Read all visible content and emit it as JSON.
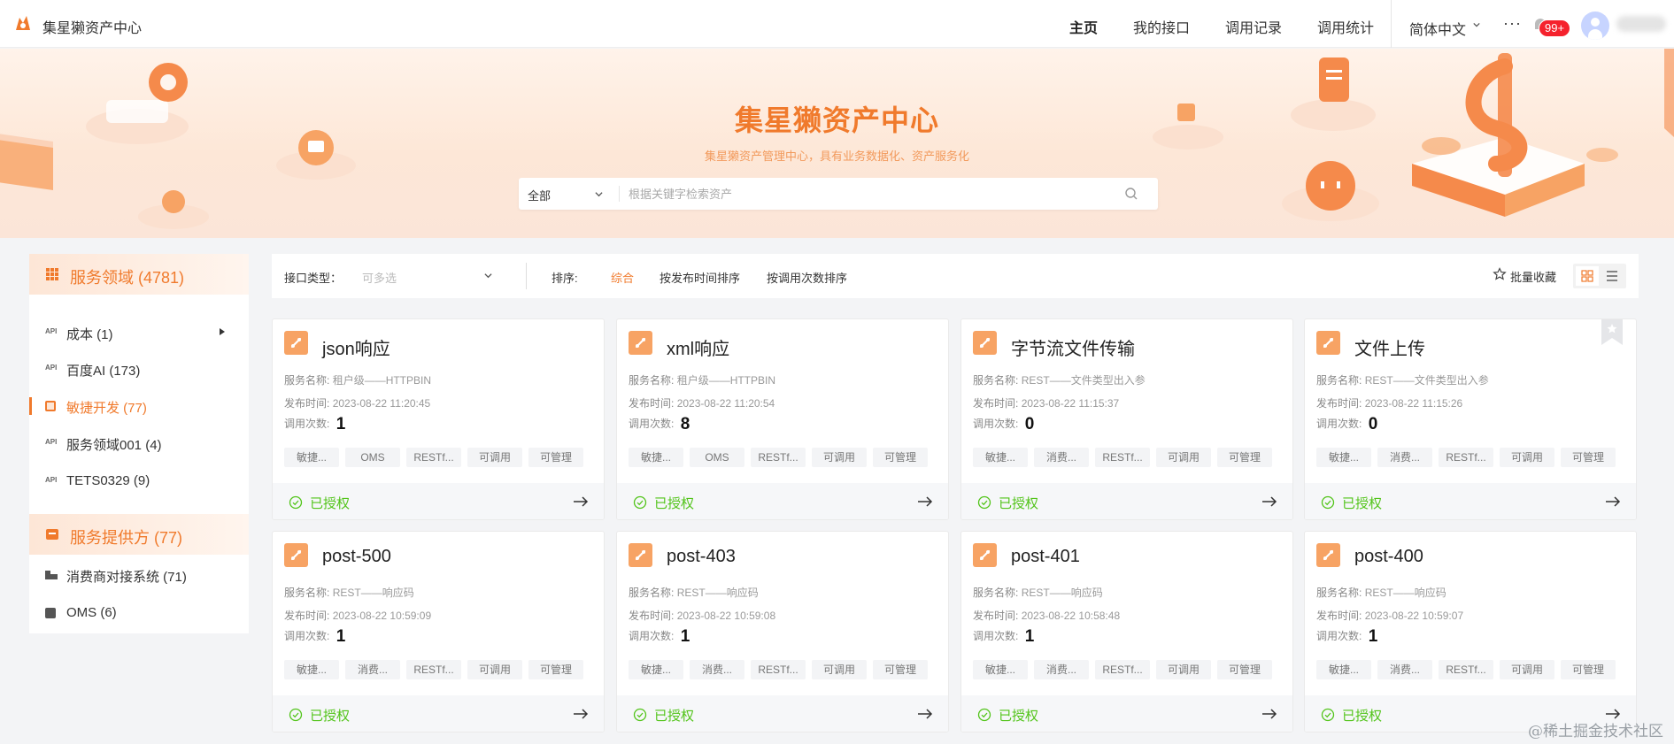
{
  "app": {
    "title": "集星獭资产中心"
  },
  "nav": {
    "items": [
      "主页",
      "我的接口",
      "调用记录",
      "调用统计"
    ],
    "language": "简体中文",
    "more": "···",
    "notification_badge": "99+"
  },
  "hero": {
    "title": "集星獭资产中心",
    "subtitle": "集星獭资产管理中心，具有业务数据化、资产服务化",
    "search": {
      "scope": "全部",
      "placeholder": "根据关键字检索资产"
    }
  },
  "sidebar": {
    "domains": {
      "header": "服务领域 (4781)",
      "items": [
        {
          "icon": "API",
          "label": "成本 (1)",
          "has_children": true,
          "active": false
        },
        {
          "icon": "API",
          "label": "百度AI (173)",
          "has_children": false,
          "active": false
        },
        {
          "icon": "square",
          "label": "敏捷开发 (77)",
          "has_children": false,
          "active": true
        },
        {
          "icon": "API",
          "label": "服务领域001 (4)",
          "has_children": false,
          "active": false
        },
        {
          "icon": "API",
          "label": "TETS0329 (9)",
          "has_children": false,
          "active": false
        }
      ]
    },
    "providers": {
      "header": "服务提供方 (77)",
      "items": [
        {
          "icon": "building",
          "label": "消费商对接系统 (71)"
        },
        {
          "icon": "square",
          "label": "OMS (6)"
        }
      ]
    }
  },
  "filter": {
    "type_label": "接口类型：",
    "type_placeholder": "可多选",
    "sort_label": "排序:",
    "sort_options": [
      "综合",
      "按发布时间排序",
      "按调用次数排序"
    ],
    "sort_active": 0,
    "batch_favorite": "批量收藏"
  },
  "labels": {
    "service_name": "服务名称:",
    "publish_time": "发布时间:",
    "call_count": "调用次数:",
    "authorized": "已授权"
  },
  "cards": [
    {
      "title": "json响应",
      "service": "租户级——HTTPBIN",
      "time": "2023-08-22 11:20:45",
      "calls": "1",
      "tags": [
        "敏捷...",
        "OMS",
        "RESTf...",
        "可调用",
        "可管理"
      ]
    },
    {
      "title": "xml响应",
      "service": "租户级——HTTPBIN",
      "time": "2023-08-22 11:20:54",
      "calls": "8",
      "tags": [
        "敏捷...",
        "OMS",
        "RESTf...",
        "可调用",
        "可管理"
      ]
    },
    {
      "title": "字节流文件传输",
      "service": "REST——文件类型出入参",
      "time": "2023-08-22 11:15:37",
      "calls": "0",
      "tags": [
        "敏捷...",
        "消费...",
        "RESTf...",
        "可调用",
        "可管理"
      ]
    },
    {
      "title": "文件上传",
      "service": "REST——文件类型出入参",
      "time": "2023-08-22 11:15:26",
      "calls": "0",
      "tags": [
        "敏捷...",
        "消费...",
        "RESTf...",
        "可调用",
        "可管理"
      ]
    },
    {
      "title": "post-500",
      "service": "REST——响应码",
      "time": "2023-08-22 10:59:09",
      "calls": "1",
      "tags": [
        "敏捷...",
        "消费...",
        "RESTf...",
        "可调用",
        "可管理"
      ]
    },
    {
      "title": "post-403",
      "service": "REST——响应码",
      "time": "2023-08-22 10:59:08",
      "calls": "1",
      "tags": [
        "敏捷...",
        "消费...",
        "RESTf...",
        "可调用",
        "可管理"
      ]
    },
    {
      "title": "post-401",
      "service": "REST——响应码",
      "time": "2023-08-22 10:58:48",
      "calls": "1",
      "tags": [
        "敏捷...",
        "消费...",
        "RESTf...",
        "可调用",
        "可管理"
      ]
    },
    {
      "title": "post-400",
      "service": "REST——响应码",
      "time": "2023-08-22 10:59:07",
      "calls": "1",
      "tags": [
        "敏捷...",
        "消费...",
        "RESTf...",
        "可调用",
        "可管理"
      ]
    }
  ],
  "watermark": "@稀土掘金技术社区",
  "colors": {
    "accent": "#f07a2c",
    "success": "#52c41a",
    "card_icon": "#f7a364"
  }
}
